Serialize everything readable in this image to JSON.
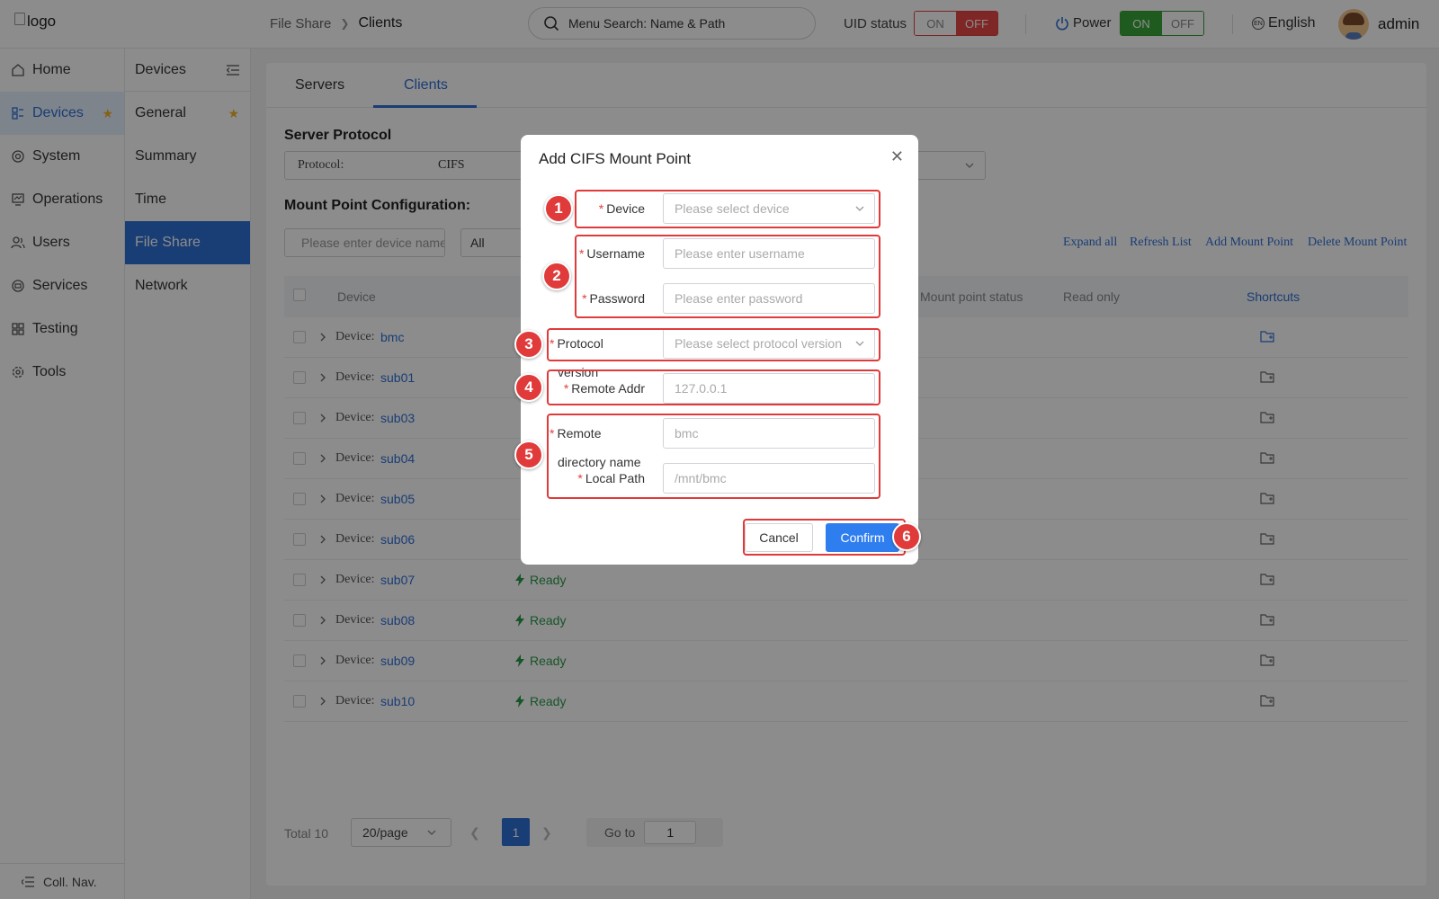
{
  "header": {
    "logo_alt": "logo",
    "breadcrumb": [
      "File Share",
      "Clients"
    ],
    "search_placeholder": "Menu Search: Name & Path",
    "uid_label": "UID status",
    "uid_on": "ON",
    "uid_off": "OFF",
    "power_label": "Power",
    "power_on": "ON",
    "power_off": "OFF",
    "language": "English",
    "user": "admin"
  },
  "nav_primary": {
    "items": [
      {
        "label": "Home",
        "icon": "home-icon"
      },
      {
        "label": "Devices",
        "icon": "devices-icon"
      },
      {
        "label": "System",
        "icon": "system-icon"
      },
      {
        "label": "Operations",
        "icon": "operations-icon"
      },
      {
        "label": "Users",
        "icon": "users-icon"
      },
      {
        "label": "Services",
        "icon": "services-icon"
      },
      {
        "label": "Testing",
        "icon": "testing-icon"
      },
      {
        "label": "Tools",
        "icon": "tools-icon"
      }
    ],
    "active": "Devices",
    "collapse_label": "Coll. Nav."
  },
  "nav_secondary": {
    "title": "Devices",
    "items": [
      "General",
      "Summary",
      "Time",
      "File Share",
      "Network"
    ],
    "active": "File Share"
  },
  "main": {
    "tabs": [
      "Servers",
      "Clients"
    ],
    "active_tab": "Clients",
    "server_protocol_title": "Server Protocol",
    "protocol_label": "Protocol:",
    "protocol_value": "CIFS",
    "mount_title": "Mount Point Configuration:",
    "filter_placeholder": "Please enter device name",
    "filter_select": "All",
    "actions": [
      "Expand all",
      "Refresh List",
      "Add Mount Point",
      "Delete Mount Point"
    ],
    "columns": {
      "device": "Device",
      "mount_status": "Mount point status",
      "read_only": "Read only",
      "shortcuts": "Shortcuts"
    },
    "device_prefix": "Device:",
    "rows": [
      {
        "name": "bmc",
        "status": ""
      },
      {
        "name": "sub01",
        "status": ""
      },
      {
        "name": "sub03",
        "status": ""
      },
      {
        "name": "sub04",
        "status": ""
      },
      {
        "name": "sub05",
        "status": ""
      },
      {
        "name": "sub06",
        "status": ""
      },
      {
        "name": "sub07",
        "status": "Ready"
      },
      {
        "name": "sub08",
        "status": "Ready"
      },
      {
        "name": "sub09",
        "status": "Ready"
      },
      {
        "name": "sub10",
        "status": "Ready"
      }
    ],
    "pager": {
      "total": "Total 10",
      "page_size": "20/page",
      "current_page": "1",
      "goto_label": "Go to",
      "goto_value": "1"
    }
  },
  "dialog": {
    "title": "Add CIFS Mount Point",
    "fields": {
      "device_label": "Device",
      "device_placeholder": "Please select device",
      "username_label": "Username",
      "username_placeholder": "Please enter username",
      "password_label": "Password",
      "password_placeholder": "Please enter password",
      "protocol_label": "Protocol",
      "protocol_label2": "version",
      "protocol_placeholder": "Please select protocol version",
      "remote_addr_label": "Remote Addr",
      "remote_addr_placeholder": "127.0.0.1",
      "remote_dir_label": "Remote",
      "remote_dir_label2": "directory name",
      "remote_dir_placeholder": "bmc",
      "local_path_label": "Local Path",
      "local_path_placeholder": "/mnt/bmc"
    },
    "cancel": "Cancel",
    "confirm": "Confirm"
  },
  "annotations": [
    "1",
    "2",
    "3",
    "4",
    "5",
    "6"
  ],
  "colors": {
    "accent": "#2f6fd6",
    "highlight": "#e03a3a",
    "ready": "#2a9a4a",
    "uid_off": "#e84545",
    "power_on": "#3aa63a"
  }
}
